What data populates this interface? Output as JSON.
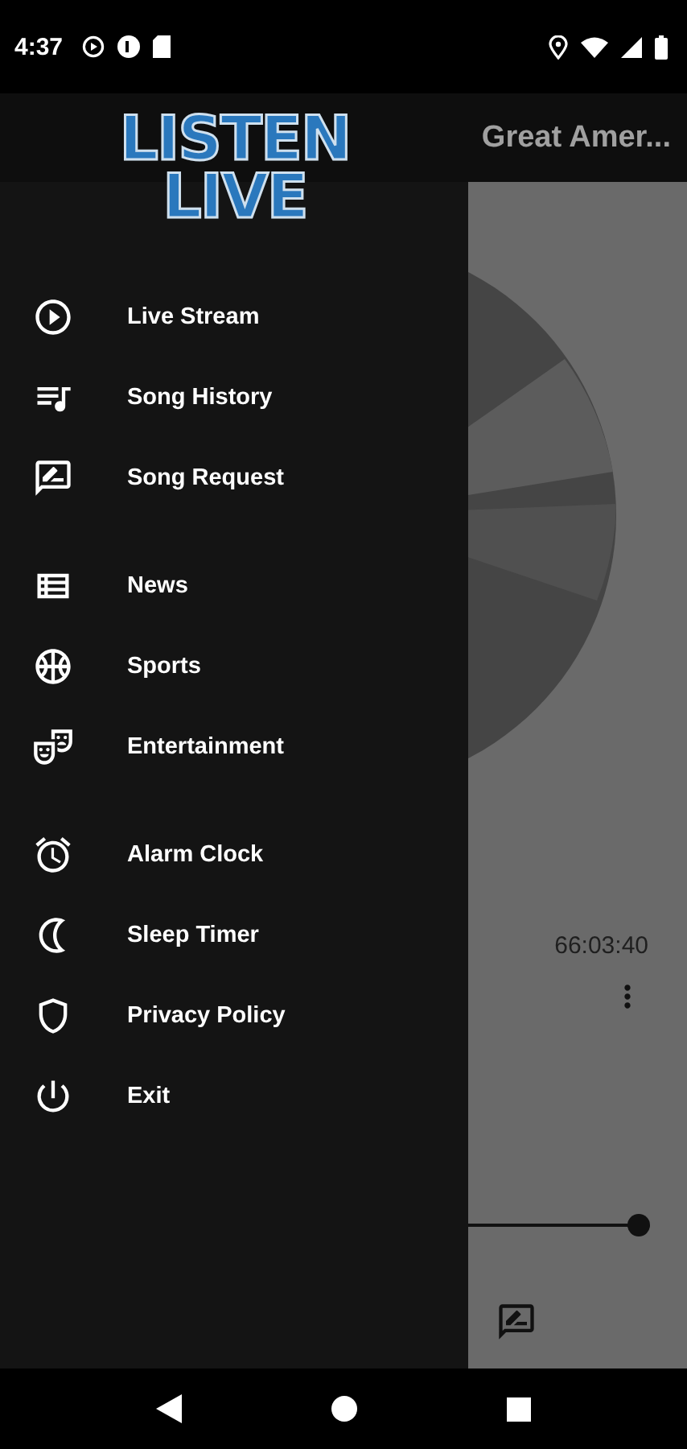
{
  "status_bar": {
    "time": "4:37"
  },
  "toolbar": {
    "title": "Great Amer..."
  },
  "logo": {
    "line_1": "LISTEN",
    "line_2": "LIVE"
  },
  "drawer": {
    "groups": [
      [
        {
          "label": "Live Stream"
        },
        {
          "label": "Song History"
        },
        {
          "label": "Song Request"
        }
      ],
      [
        {
          "label": "News"
        },
        {
          "label": "Sports"
        },
        {
          "label": "Entertainment"
        }
      ],
      [
        {
          "label": "Alarm Clock"
        },
        {
          "label": "Sleep Timer"
        },
        {
          "label": "Privacy Policy"
        },
        {
          "label": "Exit"
        }
      ]
    ]
  },
  "player": {
    "duration": "66:03:40"
  }
}
